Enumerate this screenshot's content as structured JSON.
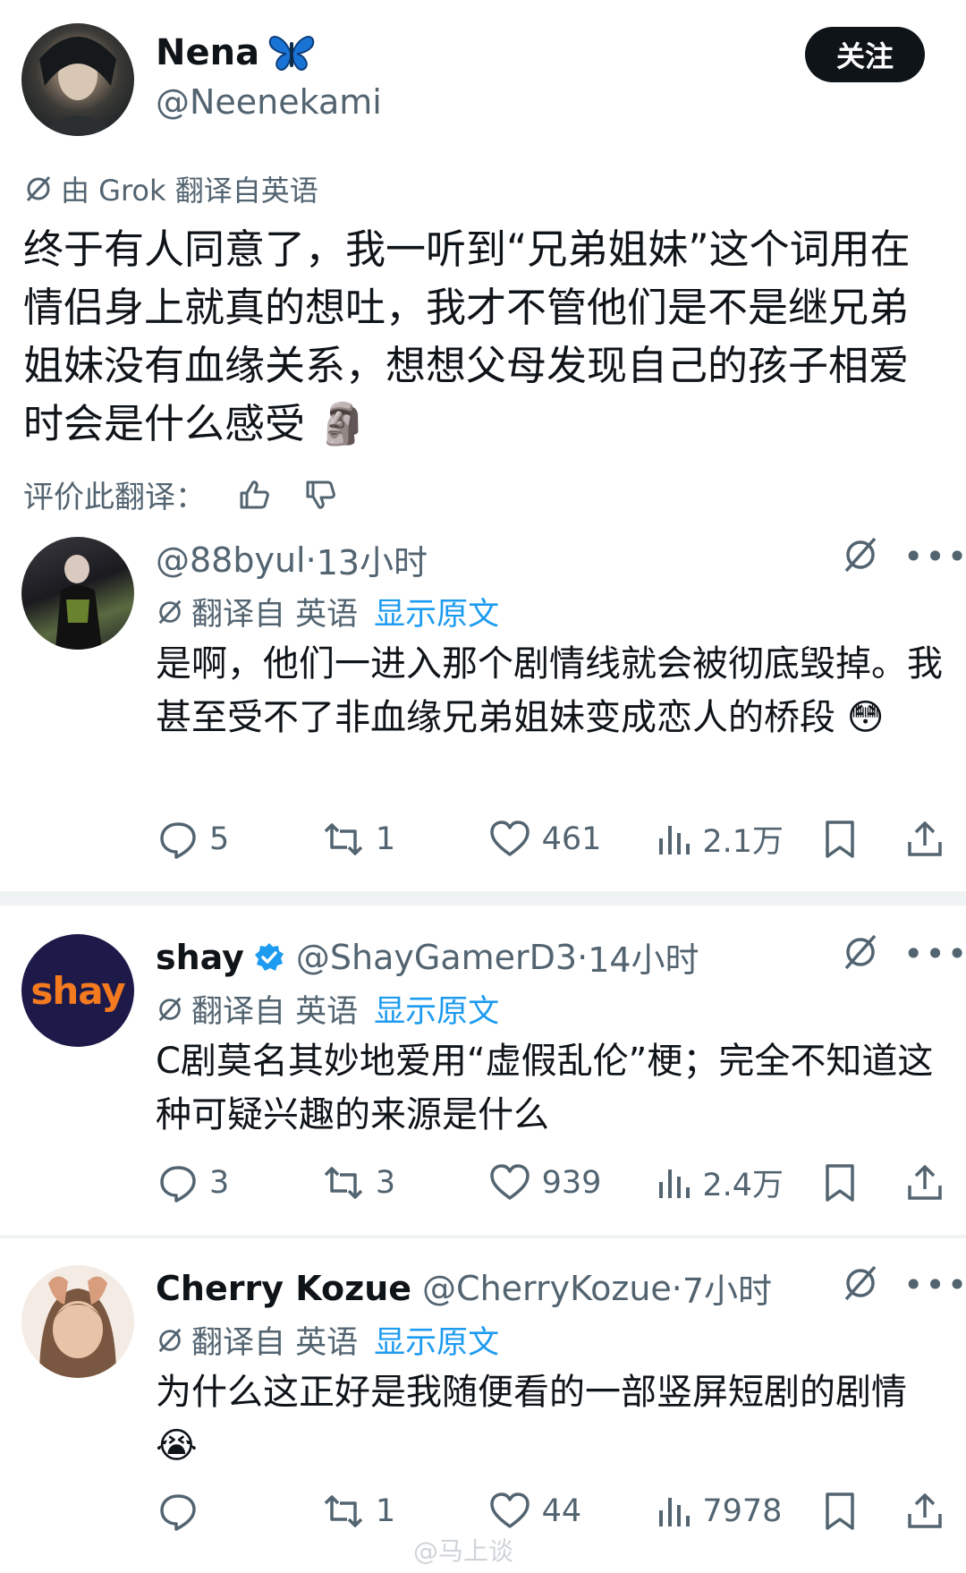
{
  "main_tweet": {
    "display_name": "Nena",
    "name_emoji": "🦋",
    "handle": "@Neenekami",
    "follow_label": "关注",
    "translated_by": "由 Grok 翻译自英语",
    "text": "终于有人同意了，我一听到“兄弟姐妹”这个词用在情侣身上就真的想吐，我才不管他们是不是继兄弟姐妹没有血缘关系，想想父母发现自己的孩子相爱时会是什么感受 🗿",
    "rate_label": "评价此翻译："
  },
  "replies": [
    {
      "display_name": "",
      "handle": "@88byul",
      "time": "13小时",
      "verified": false,
      "translated_label": "翻译自 英语",
      "show_original": "显示原文",
      "text": "是啊，他们一进入那个剧情线就会被彻底毁掉。我甚至受不了非血缘兄弟姐妹变成恋人的桥段 😳",
      "replies": "5",
      "reposts": "1",
      "likes": "461",
      "views": "2.1万"
    },
    {
      "display_name": "shay",
      "avatar_text": "shay",
      "handle": "@ShayGamerD3",
      "time": "14小时",
      "verified": true,
      "translated_label": "翻译自 英语",
      "show_original": "显示原文",
      "text": "C剧莫名其妙地爱用“虚假乱伦”梗；完全不知道这种可疑兴趣的来源是什么",
      "replies": "3",
      "reposts": "3",
      "likes": "939",
      "views": "2.4万"
    },
    {
      "display_name": "Cherry Kozue",
      "handle": "@CherryKozue",
      "time": "7小时",
      "verified": false,
      "translated_label": "翻译自 英语",
      "show_original": "显示原文",
      "text": "为什么这正好是我随便看的一部竖屏短剧的剧情 😭",
      "replies": "",
      "reposts": "1",
      "likes": "44",
      "views": "7978"
    }
  ],
  "watermark": "@马上谈",
  "colors": {
    "link": "#1d9bf0",
    "muted": "#536471",
    "text": "#0f1419",
    "verified": "#1d9bf0"
  }
}
